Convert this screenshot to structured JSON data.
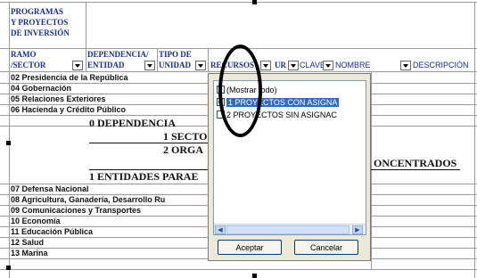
{
  "title_lines": [
    "PROGRAMAS",
    "Y PROYECTOS",
    "DE INVERSIÓN"
  ],
  "headers": {
    "ramo": "RAMO",
    "sector": "/SECTOR",
    "dependencia": "DEPENDENCIA/",
    "entidad": "ENTIDAD",
    "tipo_de": "TIPO DE",
    "unidad": "UNIDAD",
    "recursos": "RECURSOS",
    "ur": "UR",
    "clave": "CLAVE",
    "nombre": "NOMBRE",
    "descripcion": "DESCRIPCIÓN"
  },
  "rows": {
    "r02": "02 Presidencia de la República",
    "r04": "04 Gobernación",
    "r05": "05 Relaciones Exteriores",
    "r06": "06 Hacienda y Crédito Público",
    "dependencia": "0 DEPENDENCIA",
    "secto": "1 SECTO",
    "orga": "2 ORGA",
    "oncentrados": "ONCENTRADOS",
    "entidades": "1 ENTIDADES PARAE",
    "r07": "07 Defensa Nacional",
    "r08": "08 Agricultura, Ganadería, Desarrollo Ru",
    "r09": "09 Comunicaciones y Transportes",
    "r10": "10 Economía",
    "r11": "11 Educación Pública",
    "r12": "12 Salud",
    "r13": "13 Marina"
  },
  "filter_popup": {
    "items": [
      {
        "label": "(Mostrar todo)",
        "checked": false
      },
      {
        "label": "1 PROYECTOS CON ASIGNA",
        "checked": true
      },
      {
        "label": "2 PROYECTOS SIN ASIGNAC",
        "checked": false
      }
    ],
    "accept_label": "Aceptar",
    "cancel_label": "Cancelar"
  },
  "icons": {
    "dropdown": "chevron-down-icon",
    "scroll_left": "scroll-left-icon",
    "scroll_right": "scroll-right-icon",
    "check": "check-icon"
  },
  "colors": {
    "header_text": "#1a2e8c",
    "selection": "#316ac5",
    "check": "#21a121",
    "dialog_bg": "#ece9d8"
  }
}
